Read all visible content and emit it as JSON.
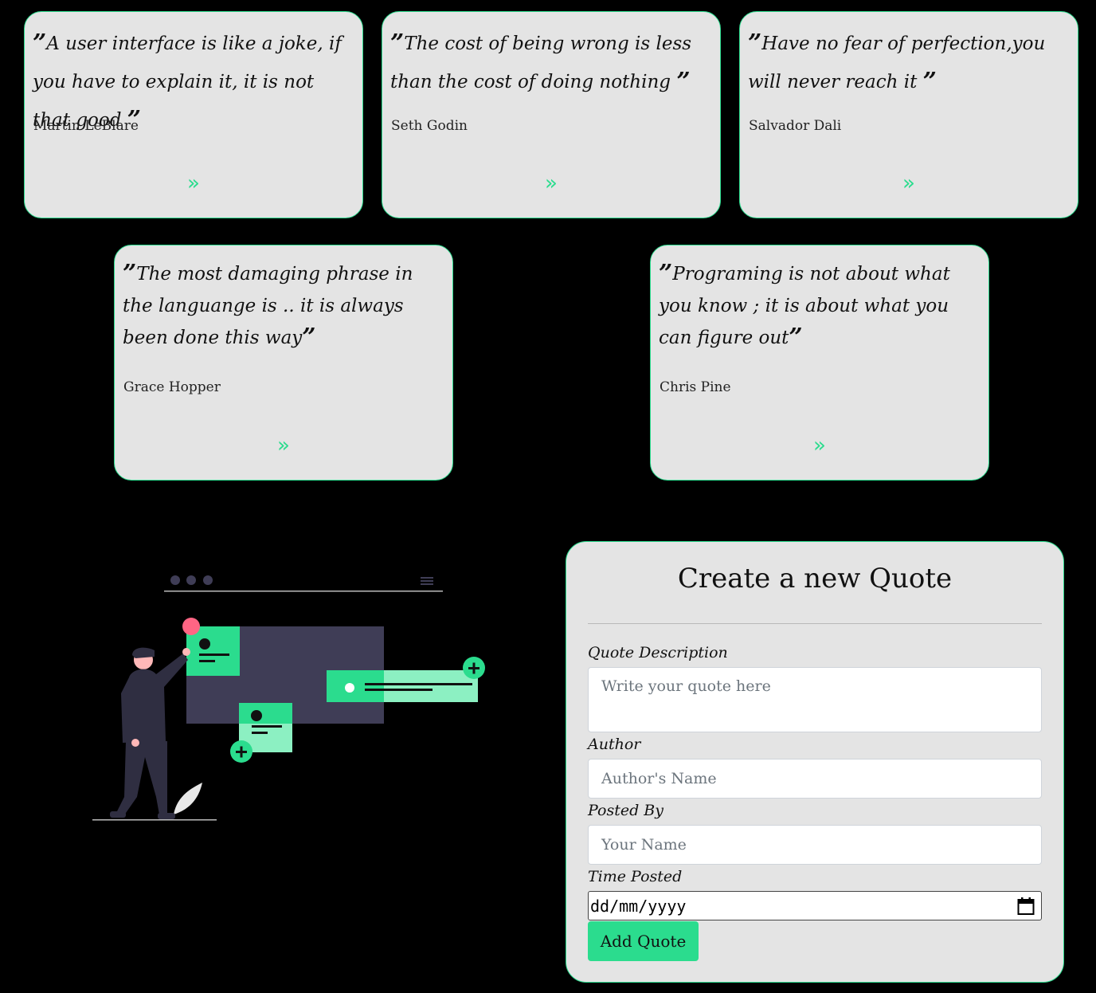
{
  "quotes": [
    {
      "text": "A user interface is like a joke, if you have to explain it, it is not that good",
      "author": "Martin LeBlare",
      "more_icon": "double-chevron-right-icon"
    },
    {
      "text": "The cost of being wrong is less than the cost of doing nothing",
      "author": "Seth Godin",
      "more_icon": "double-chevron-right-icon"
    },
    {
      "text": "Have no fear of perfection,you will never reach it",
      "author": "Salvador Dali",
      "more_icon": "double-chevron-right-icon"
    },
    {
      "text": "The most damaging phrase in the languange is .. it is always been done this way",
      "author": "Grace Hopper",
      "more_icon": "double-chevron-right-icon"
    },
    {
      "text": "Programing is not about what you know ; it is about what you can figure out",
      "author": "Chris Pine",
      "more_icon": "double-chevron-right-icon"
    }
  ],
  "quote_open": "”",
  "quote_close": "”",
  "more_glyph": "»",
  "form": {
    "title": "Create a new Quote",
    "description_label": "Quote Description",
    "description_placeholder": "Write your quote here",
    "author_label": "Author",
    "author_placeholder": "Author's Name",
    "posted_by_label": "Posted By",
    "posted_by_placeholder": "Your Name",
    "time_label": "Time Posted",
    "time_placeholder": "dd/mm/yyyy",
    "submit_label": "Add Quote"
  },
  "colors": {
    "accent": "#2bdc8e",
    "card_bg": "#e4e4e4",
    "page_bg": "#000000",
    "illustration_dark": "#3f3d56",
    "illustration_pink": "#ff6584"
  }
}
